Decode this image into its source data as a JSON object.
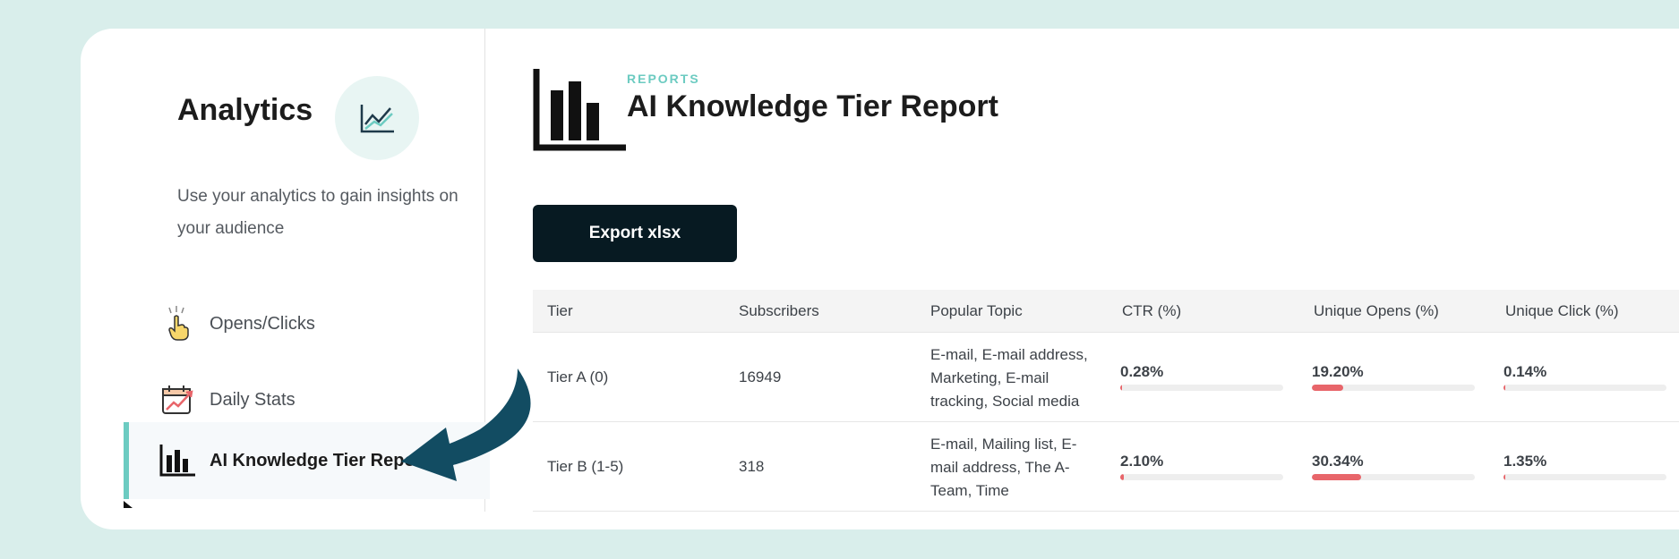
{
  "sidebar": {
    "title": "Analytics",
    "description": "Use your analytics to gain insights on your audience",
    "items": [
      {
        "label": "Opens/Clicks",
        "icon": "pointing-hand-icon"
      },
      {
        "label": "Daily Stats",
        "icon": "calendar-chart-icon"
      },
      {
        "label": "AI Knowledge Tier Reports",
        "icon": "bar-chart-icon",
        "active": true
      }
    ]
  },
  "main": {
    "kicker": "REPORTS",
    "title": "AI Knowledge Tier Report",
    "export_label": "Export xlsx",
    "table": {
      "headers": [
        "Tier",
        "Subscribers",
        "Popular Topic",
        "CTR (%)",
        "Unique Opens (%)",
        "Unique Click (%)"
      ],
      "rows": [
        {
          "tier": "Tier A (0)",
          "subscribers": "16949",
          "topic": "E-mail, E-mail address, Marketing, E-mail tracking, Social media",
          "ctr": "0.28%",
          "ctr_value": 0.28,
          "opens": "19.20%",
          "opens_value": 19.2,
          "clicks": "0.14%",
          "clicks_value": 0.14
        },
        {
          "tier": "Tier B (1-5)",
          "subscribers": "318",
          "topic": "E-mail, Mailing list, E-mail address, The A-Team, Time",
          "ctr": "2.10%",
          "ctr_value": 2.1,
          "opens": "30.34%",
          "opens_value": 30.34,
          "clicks": "1.35%",
          "clicks_value": 1.35
        }
      ]
    }
  },
  "colors": {
    "accent": "#6ccbc1",
    "button": "#071a22",
    "bar_fill": "#e8656a",
    "background": "#d9eeeb"
  }
}
